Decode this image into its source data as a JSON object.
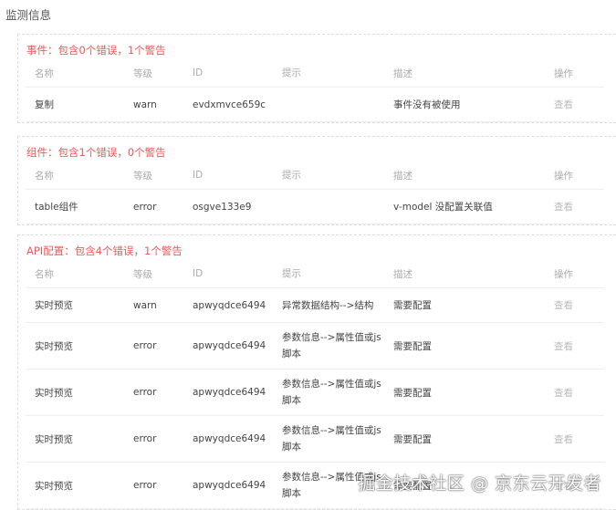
{
  "page_title": "监测信息",
  "columns": [
    "名称",
    "等级",
    "ID",
    "提示",
    "描述",
    "操作"
  ],
  "sections": [
    {
      "title": "事件：包含0个错误，1个警告",
      "rows": [
        {
          "name": "复制",
          "level": "warn",
          "id": "evdxmvce659c",
          "hint": "",
          "desc": "事件没有被使用",
          "op": "查看"
        }
      ]
    },
    {
      "title": "组件：包含1个错误，0个警告",
      "rows": [
        {
          "name": "table组件",
          "level": "error",
          "id": "osgve133e9",
          "hint": "",
          "desc": "v-model 没配置关联值",
          "op": "查看"
        }
      ]
    },
    {
      "title": "API配置：包含4个错误，1个警告",
      "rows": [
        {
          "name": "实时预览",
          "level": "warn",
          "id": "apwyqdce6494",
          "hint": "异常数据结构-->结构",
          "desc": "需要配置",
          "op": "查看"
        },
        {
          "name": "实时预览",
          "level": "error",
          "id": "apwyqdce6494",
          "hint": "参数信息-->属性值或js脚本",
          "desc": "需要配置",
          "op": "查看"
        },
        {
          "name": "实时预览",
          "level": "error",
          "id": "apwyqdce6494",
          "hint": "参数信息-->属性值或js脚本",
          "desc": "需要配置",
          "op": "查看"
        },
        {
          "name": "实时预览",
          "level": "error",
          "id": "apwyqdce6494",
          "hint": "参数信息-->属性值或js脚本",
          "desc": "需要配置",
          "op": "查看"
        },
        {
          "name": "实时预览",
          "level": "error",
          "id": "apwyqdce6494",
          "hint": "参数信息-->属性值或js脚本",
          "desc": "需要配置",
          "op": "查看"
        }
      ]
    }
  ],
  "watermark": "掘金技术社区 @ 京东云开发者"
}
